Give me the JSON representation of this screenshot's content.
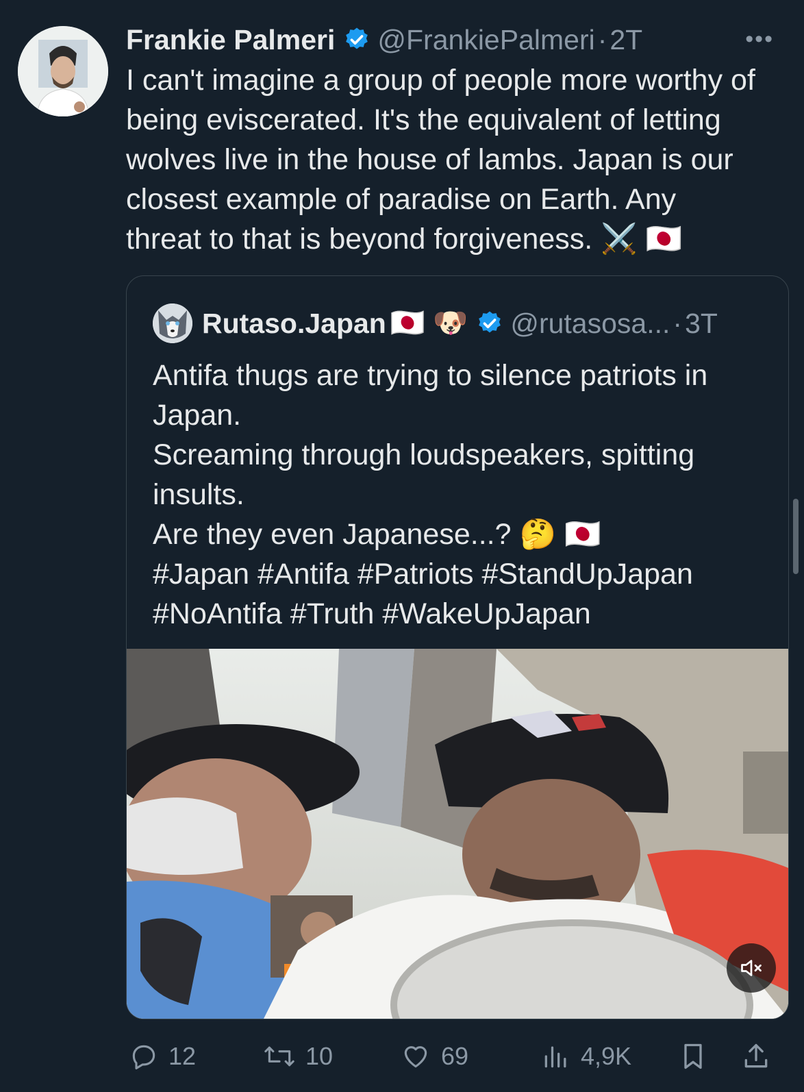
{
  "tweet": {
    "author_name": "Frankie Palmeri",
    "author_handle": "@FrankiePalmeri",
    "separator": "·",
    "time": "2T",
    "more_label": "•••",
    "text_lines": [
      "I can't imagine a group of people more worthy of",
      "being eviscerated. It's the equivalent of letting",
      "wolves live in the house of lambs. Japan is our",
      "closest example of paradise on Earth. Any",
      "threat to that is beyond forgiveness. "
    ],
    "text_emojis": "⚔️ 🇯🇵"
  },
  "quote": {
    "author_name": "Rutaso.Japan",
    "name_emojis": "🇯🇵 🐶",
    "author_handle": "@rutasosa...",
    "separator": "·",
    "time": "3T",
    "text_lines": [
      "Antifa thugs are trying to silence patriots in",
      "Japan.",
      "Screaming through loudspeakers, spitting",
      "insults.",
      "Are they even Japanese...? "
    ],
    "line5_emojis": "🤔 🇯🇵",
    "hashtag_lines": [
      "#Japan #Antifa #Patriots #StandUpJapan",
      "#NoAntifa #Truth #WakeUpJapan"
    ]
  },
  "actions": {
    "replies": "12",
    "reposts": "10",
    "likes": "69",
    "views": "4,9K"
  },
  "icons": {
    "verified": "verified-badge-icon",
    "reply": "reply-icon",
    "repost": "repost-icon",
    "like": "heart-icon",
    "views": "views-icon",
    "bookmark": "bookmark-icon",
    "share": "share-icon",
    "mute": "muted-speaker-icon"
  },
  "colors": {
    "background": "#15202b",
    "text": "#e7e9ea",
    "muted": "#8b98a5",
    "verified": "#1d9bf0",
    "border": "#38444d"
  }
}
